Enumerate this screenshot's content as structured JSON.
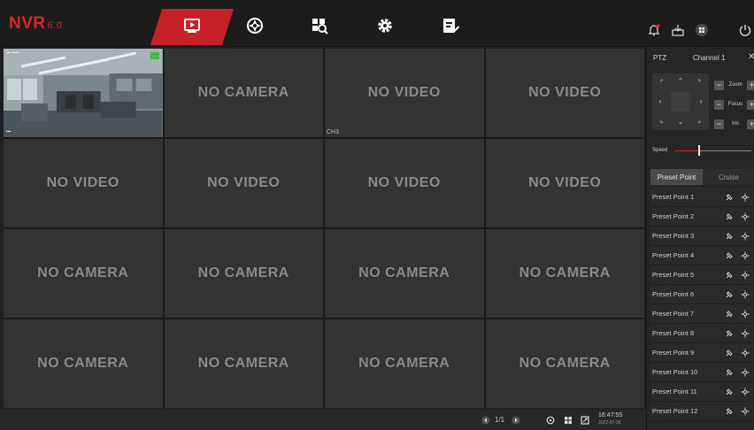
{
  "header": {
    "logo_text": "NVR",
    "logo_version": "6.0",
    "nav_icons": [
      "live-view-icon",
      "playback-icon",
      "search-icon",
      "settings-gear-icon",
      "maintenance-icon"
    ],
    "system_icons": [
      "alarm-bell-icon",
      "backup-icon",
      "view-layout-icon",
      "power-icon"
    ],
    "accent_color": "#c52127"
  },
  "grid": {
    "cells": [
      {
        "message": "",
        "label": ""
      },
      {
        "message": "NO CAMERA",
        "label": ""
      },
      {
        "message": "NO VIDEO",
        "label": "CH3"
      },
      {
        "message": "NO VIDEO",
        "label": ""
      },
      {
        "message": "NO VIDEO",
        "label": ""
      },
      {
        "message": "NO VIDEO",
        "label": ""
      },
      {
        "message": "NO VIDEO",
        "label": ""
      },
      {
        "message": "NO VIDEO",
        "label": ""
      },
      {
        "message": "NO CAMERA",
        "label": ""
      },
      {
        "message": "NO CAMERA",
        "label": ""
      },
      {
        "message": "NO CAMERA",
        "label": ""
      },
      {
        "message": "NO CAMERA",
        "label": ""
      },
      {
        "message": "NO CAMERA",
        "label": ""
      },
      {
        "message": "NO CAMERA",
        "label": ""
      },
      {
        "message": "NO CAMERA",
        "label": ""
      },
      {
        "message": "NO CAMERA",
        "label": ""
      }
    ]
  },
  "bottom_bar": {
    "page_indicator": "1/1",
    "time": "16:47:55",
    "date": "2022-07-25"
  },
  "ptz": {
    "title": "PTZ",
    "channel": "Channel 1",
    "close": "✕",
    "zoom_label": "Zoom",
    "focus_label": "Focus",
    "iris_label": "Iris",
    "speed_label": "Speed",
    "speed_level_fraction": 0.3,
    "tabs": [
      "Preset Point",
      "Cruise"
    ],
    "active_tab": "Preset Point",
    "presets": [
      "Preset Point 1",
      "Preset Point 2",
      "Preset Point 3",
      "Preset Point 4",
      "Preset Point 5",
      "Preset Point 6",
      "Preset Point 7",
      "Preset Point 8",
      "Preset Point 9",
      "Preset Point 10",
      "Preset Point 11",
      "Preset Point 12"
    ]
  }
}
